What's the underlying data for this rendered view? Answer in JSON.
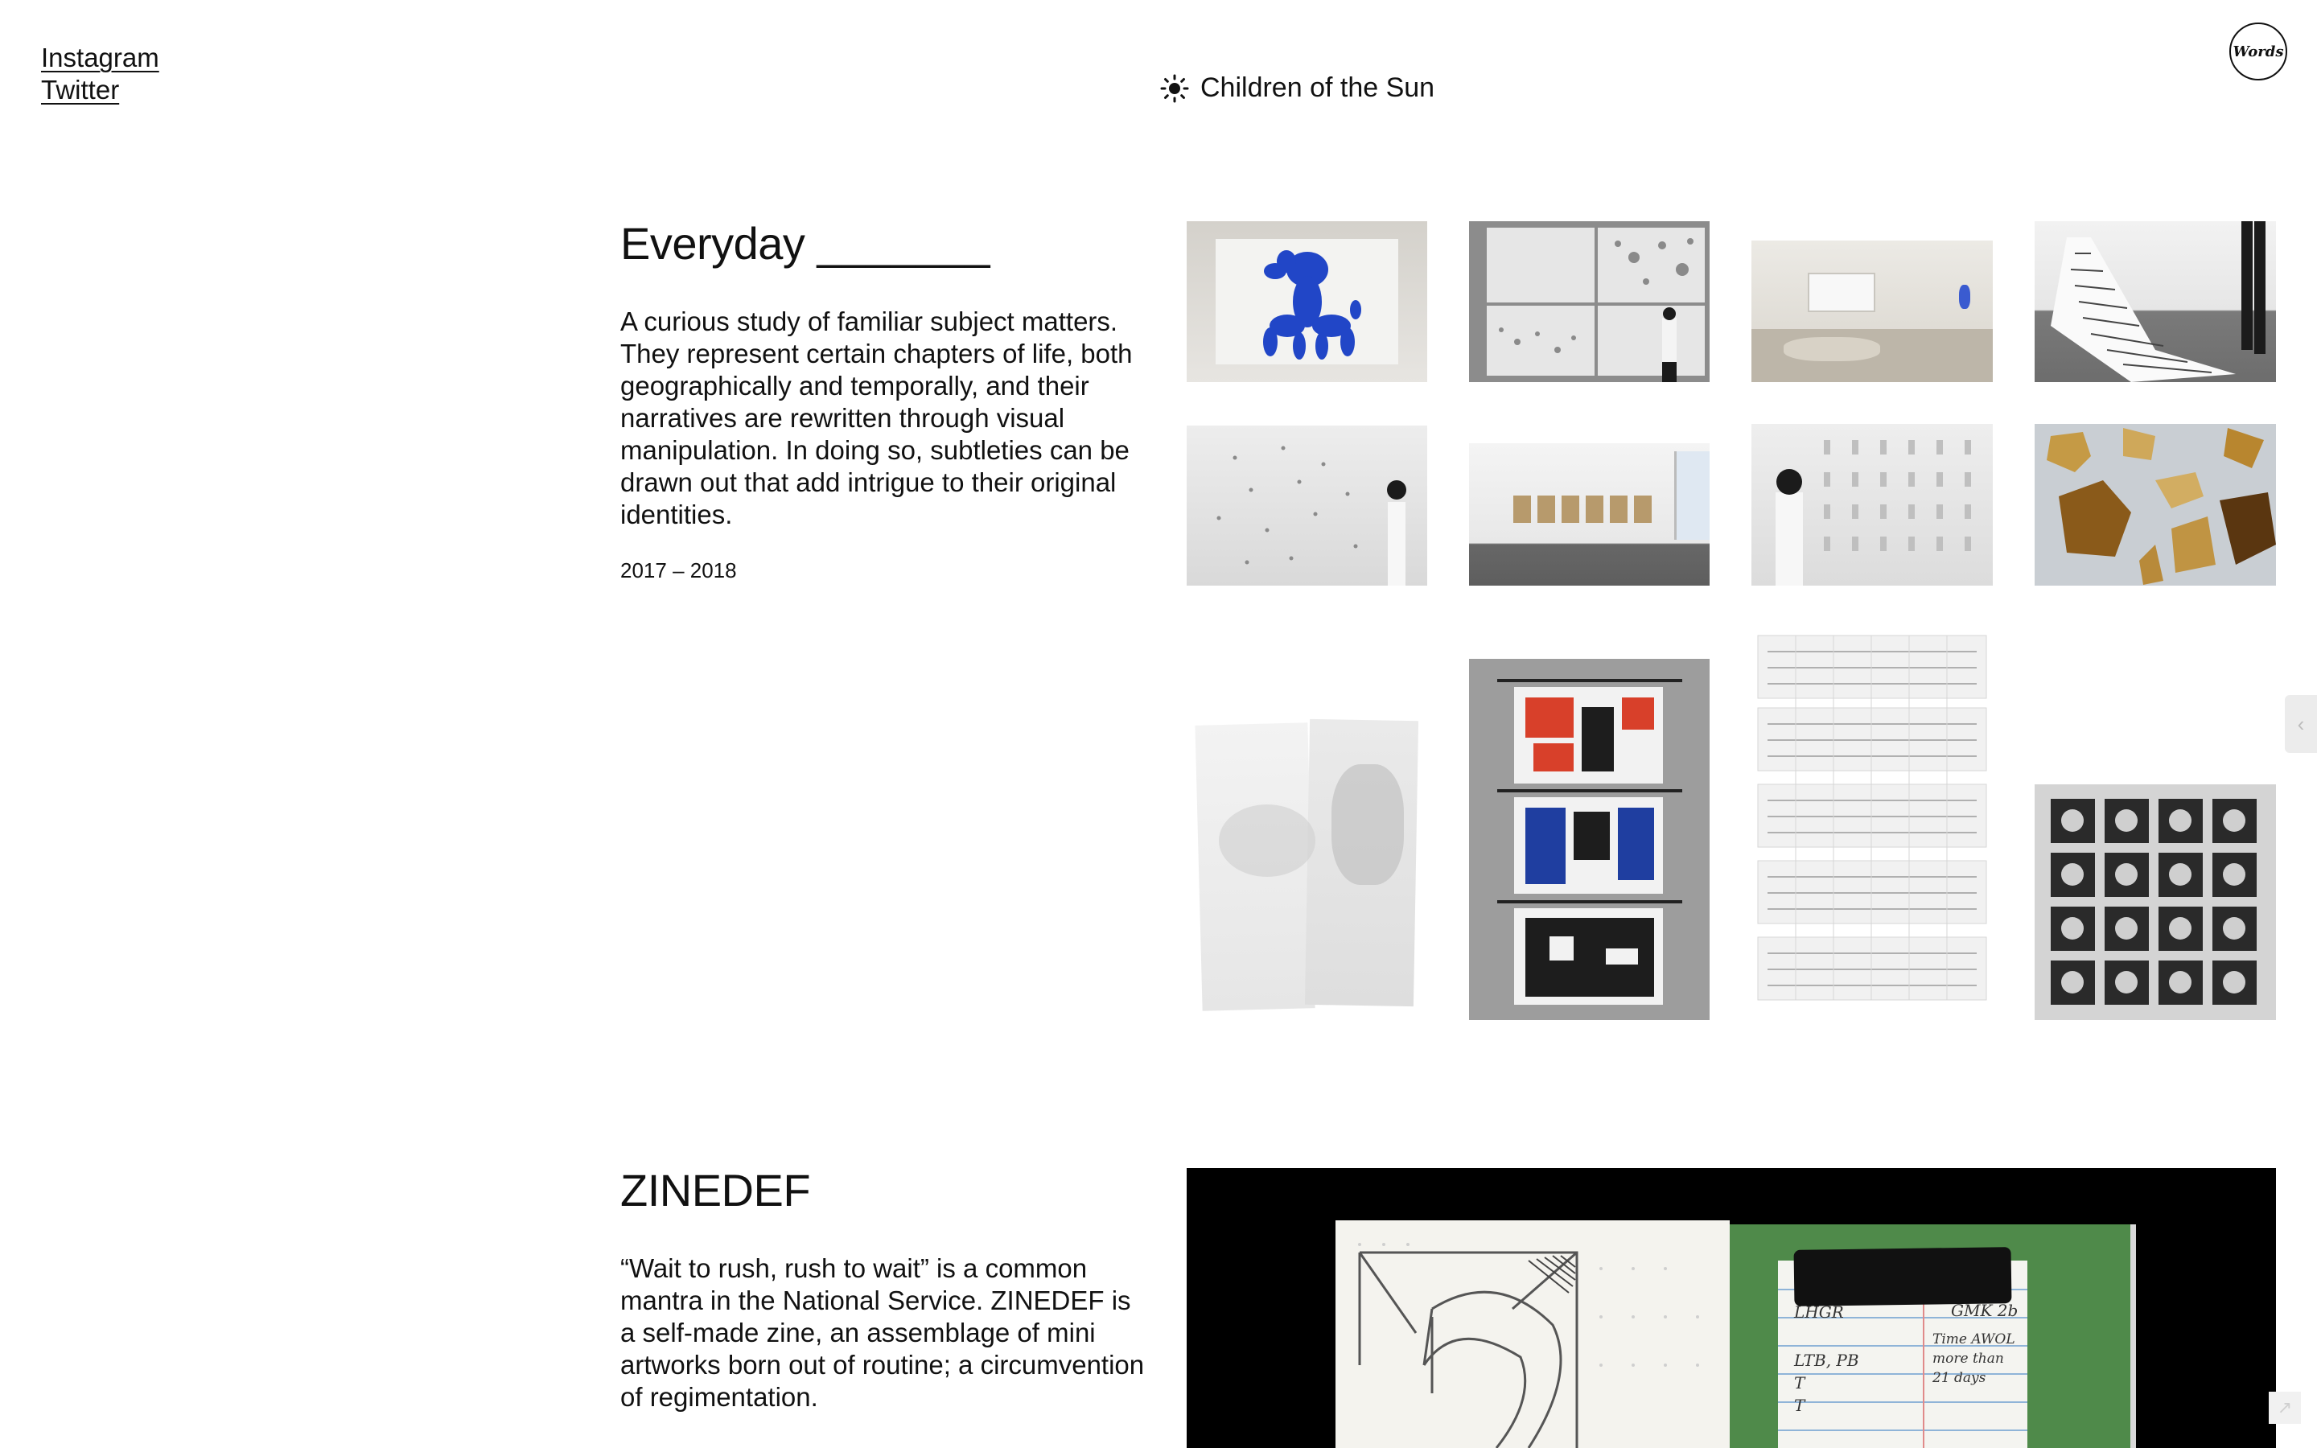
{
  "header": {
    "social_links": [
      "Instagram",
      "Twitter"
    ],
    "brand": {
      "name": "Children of the Sun",
      "icon": "sun-icon"
    },
    "words_button": {
      "label": "Words"
    }
  },
  "projects": [
    {
      "title": "Everyday _______",
      "description": "A curious study of familiar subject matters. They represent certain chapters of life, both geographically and temporally, and their narratives are rewritten through visual manipulation. In doing so, subtleties can be drawn out that add intrigue to their original identities.",
      "years": "2017 – 2018"
    },
    {
      "title": "ZINEDEF",
      "description": "“Wait to rush, rush to wait” is a common mantra in the National Service. ZINEDEF is a self-made zine, an assemblage of mini artworks born out of routine; a circumvention of regimentation.",
      "zine_notes": [
        "LHGR",
        "GMK 2b",
        "LTB, PB",
        "T",
        "T",
        "Time AWOL more than 21 days"
      ]
    }
  ],
  "controls": {
    "gallery_prev_icon": "chevron-left-icon",
    "corner_icon": "arrow-icon"
  },
  "colors": {
    "text": "#111111",
    "background": "#ffffff",
    "balloon_blue": "#2146c7",
    "zine_green": "#4f8a4a"
  }
}
